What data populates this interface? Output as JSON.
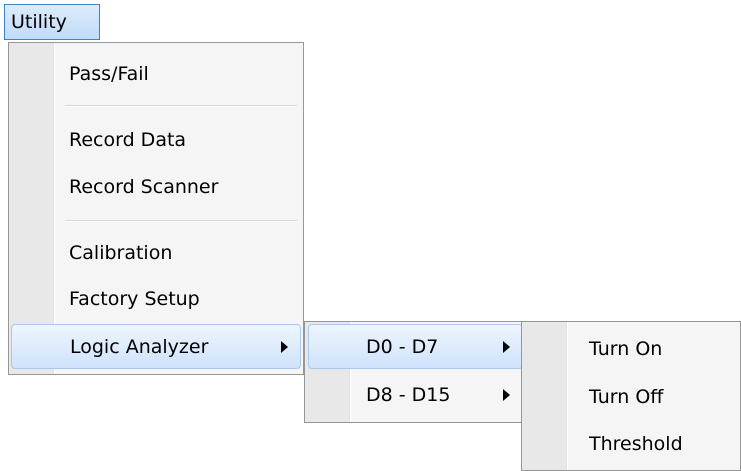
{
  "menubar": {
    "utility_label": "Utility"
  },
  "main_menu": {
    "items": [
      {
        "label": "Pass/Fail"
      },
      {
        "label": "Record Data"
      },
      {
        "label": "Record Scanner"
      },
      {
        "label": "Calibration"
      },
      {
        "label": "Factory Setup"
      },
      {
        "label": "Logic Analyzer",
        "has_submenu": true,
        "highlighted": true
      }
    ]
  },
  "channel_menu": {
    "items": [
      {
        "label": "D0 - D7",
        "has_submenu": true,
        "highlighted": true
      },
      {
        "label": "D8 - D15",
        "has_submenu": true
      }
    ]
  },
  "action_menu": {
    "items": [
      {
        "label": "Turn On"
      },
      {
        "label": "Turn Off"
      },
      {
        "label": "Threshold"
      }
    ]
  },
  "colors": {
    "highlight_border": "#a8c8ec",
    "highlight_fill": "#cfe3fb",
    "menubar_border": "#3f81c8",
    "menu_background": "#f5f5f5",
    "menu_border": "#979797"
  },
  "icons": {
    "submenu_arrow": "submenu-arrow-icon"
  }
}
